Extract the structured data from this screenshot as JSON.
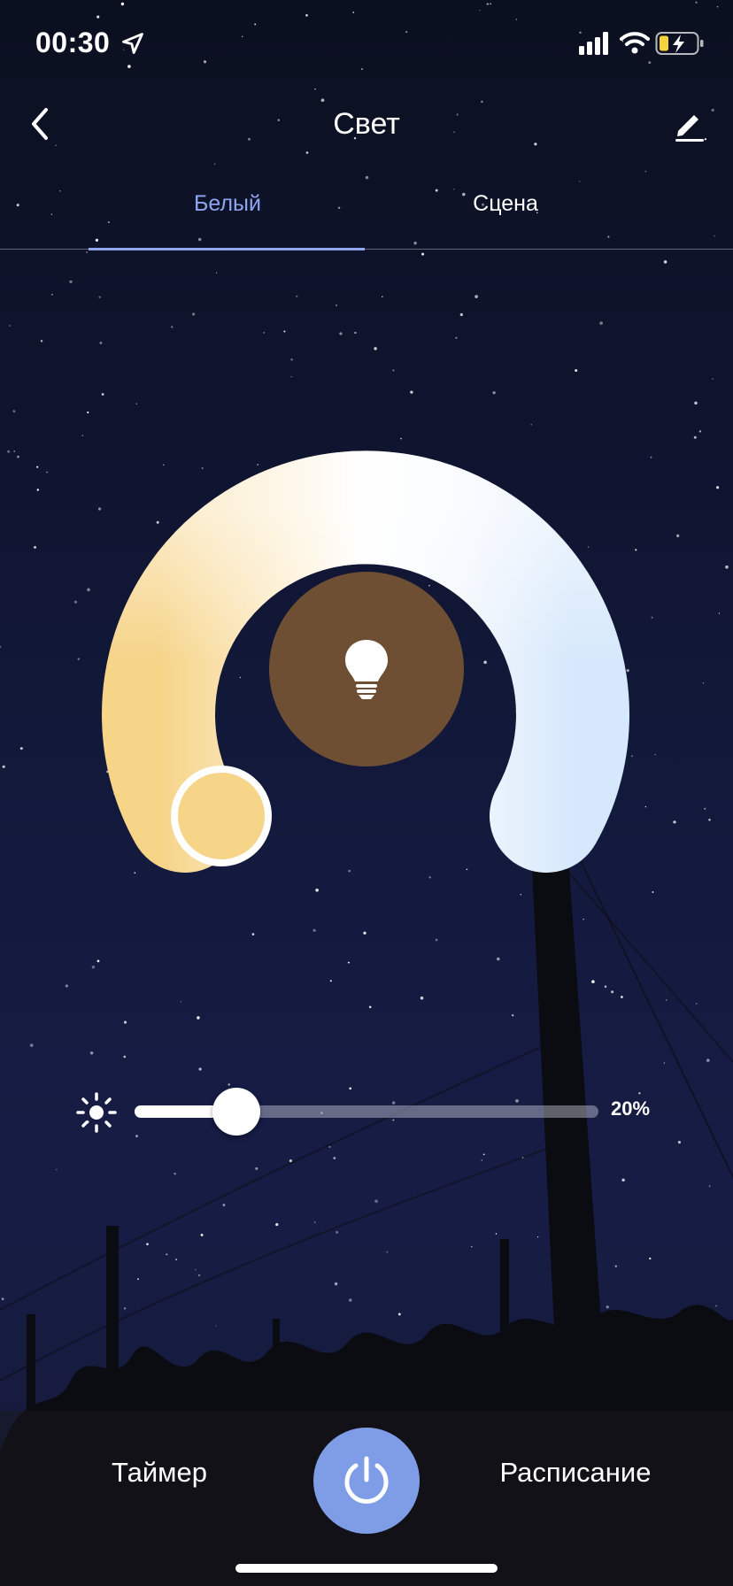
{
  "status_bar": {
    "time": "00:30",
    "icons": [
      "location-arrow-icon",
      "signal-icon",
      "wifi-icon",
      "battery-charging-icon"
    ]
  },
  "header": {
    "title": "Свет",
    "back_icon": "chevron-left-icon",
    "edit_icon": "pencil-icon"
  },
  "tabs": [
    {
      "label": "Белый",
      "active": true
    },
    {
      "label": "Сцена",
      "active": false
    }
  ],
  "colors": {
    "accent": "#8ea6f0",
    "power_button": "#7f9de6",
    "bulb_circle": "#6f4f34",
    "warm_white": "#f6d488",
    "cool_white": "#d6e8fb"
  },
  "color_wheel": {
    "center_icon": "lightbulb-icon",
    "warm_color": "#f6d488",
    "cool_color": "#d6e8fb"
  },
  "brightness": {
    "icon": "sun-icon",
    "value": 0.2,
    "label": "20%"
  },
  "bottom_bar": {
    "timer_label": "Таймер",
    "schedule_label": "Расписание",
    "power_icon": "power-icon"
  }
}
